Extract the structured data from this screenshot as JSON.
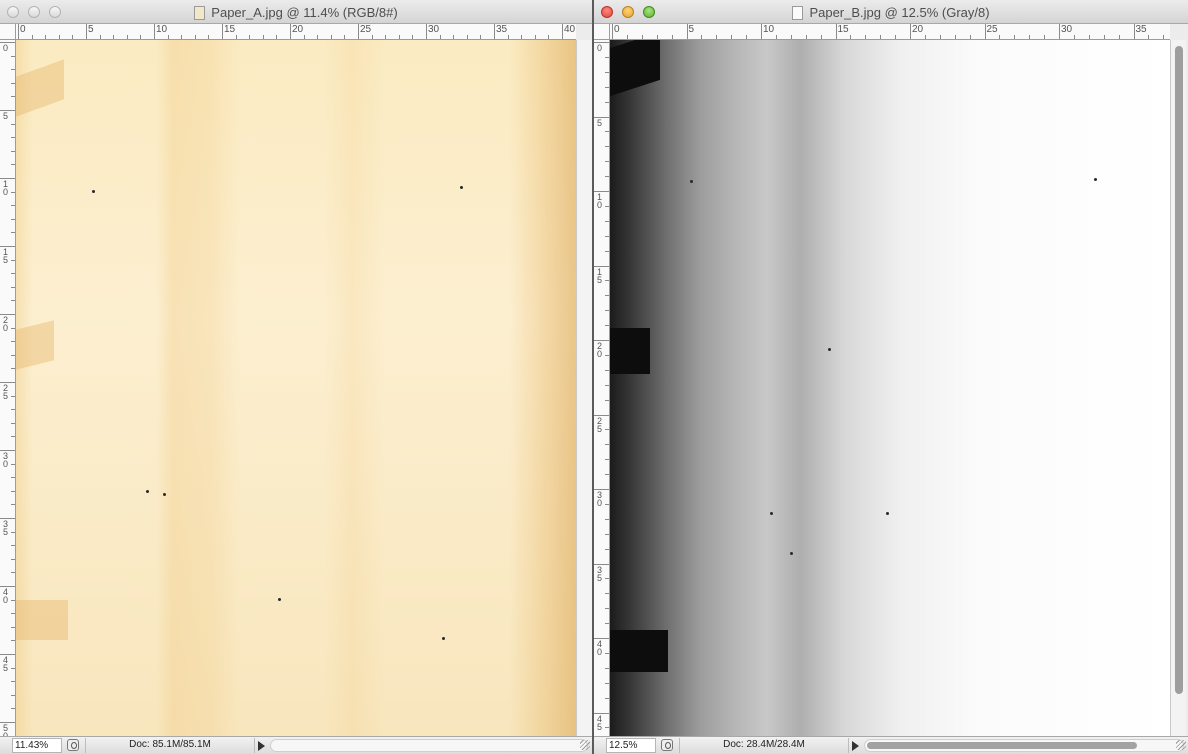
{
  "windows": [
    {
      "title": "Paper_A.jpg @ 11.4% (RGB/8#)",
      "zoom": "11.43%",
      "doc_size": "Doc: 85.1M/85.1M",
      "ruler_h": [
        "0",
        "5",
        "10",
        "15",
        "20",
        "25",
        "30",
        "35",
        "40"
      ],
      "ruler_v": [
        "0",
        "5",
        "10",
        "15",
        "20",
        "25",
        "30",
        "35",
        "40",
        "45",
        "50"
      ],
      "active": false
    },
    {
      "title": "Paper_B.jpg @ 12.5% (Gray/8)",
      "zoom": "12.5%",
      "doc_size": "Doc: 28.4M/28.4M",
      "ruler_h": [
        "0",
        "5",
        "10",
        "15",
        "20",
        "25",
        "30",
        "35"
      ],
      "ruler_v": [
        "0",
        "5",
        "10",
        "15",
        "20",
        "25",
        "30",
        "35",
        "40",
        "45"
      ],
      "active": true
    }
  ]
}
